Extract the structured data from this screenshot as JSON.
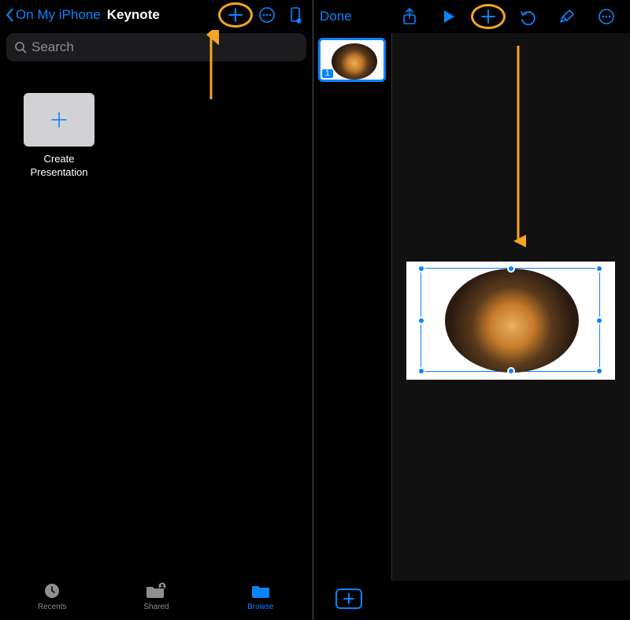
{
  "left": {
    "back_label": "On My iPhone",
    "title": "Keynote",
    "search_placeholder": "Search",
    "create_label": "Create Presentation",
    "tabs": {
      "recents": "Recents",
      "shared": "Shared",
      "browse": "Browse"
    }
  },
  "right": {
    "done_label": "Done",
    "slide_number": "1"
  }
}
